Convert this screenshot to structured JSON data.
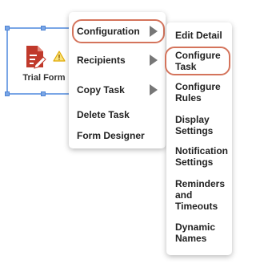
{
  "task_node": {
    "label": "Trial Form",
    "icon": "form-edit-icon",
    "warning_icon": "warning-triangle-icon"
  },
  "context_menu": {
    "items": [
      {
        "label": "Configuration",
        "has_submenu": true,
        "highlighted": true
      },
      {
        "label": "Recipients",
        "has_submenu": true
      },
      {
        "label": "Copy Task",
        "has_submenu": true
      },
      {
        "label": "Delete Task"
      },
      {
        "label": "Form Designer"
      }
    ]
  },
  "submenu": {
    "items": [
      {
        "label": "Edit Detail"
      },
      {
        "label": "Configure\nTask",
        "highlighted": true
      },
      {
        "label": "Configure\nRules"
      },
      {
        "label": "Display\nSettings"
      },
      {
        "label": "Notification\nSettings"
      },
      {
        "label": "Reminders\nand\nTimeouts"
      },
      {
        "label": "Dynamic\nNames"
      }
    ]
  },
  "colors": {
    "selection": "#7aa6e6",
    "highlight_ring": "#d4745c",
    "form_icon": "#c0392b",
    "warning": "#f1c40f"
  }
}
